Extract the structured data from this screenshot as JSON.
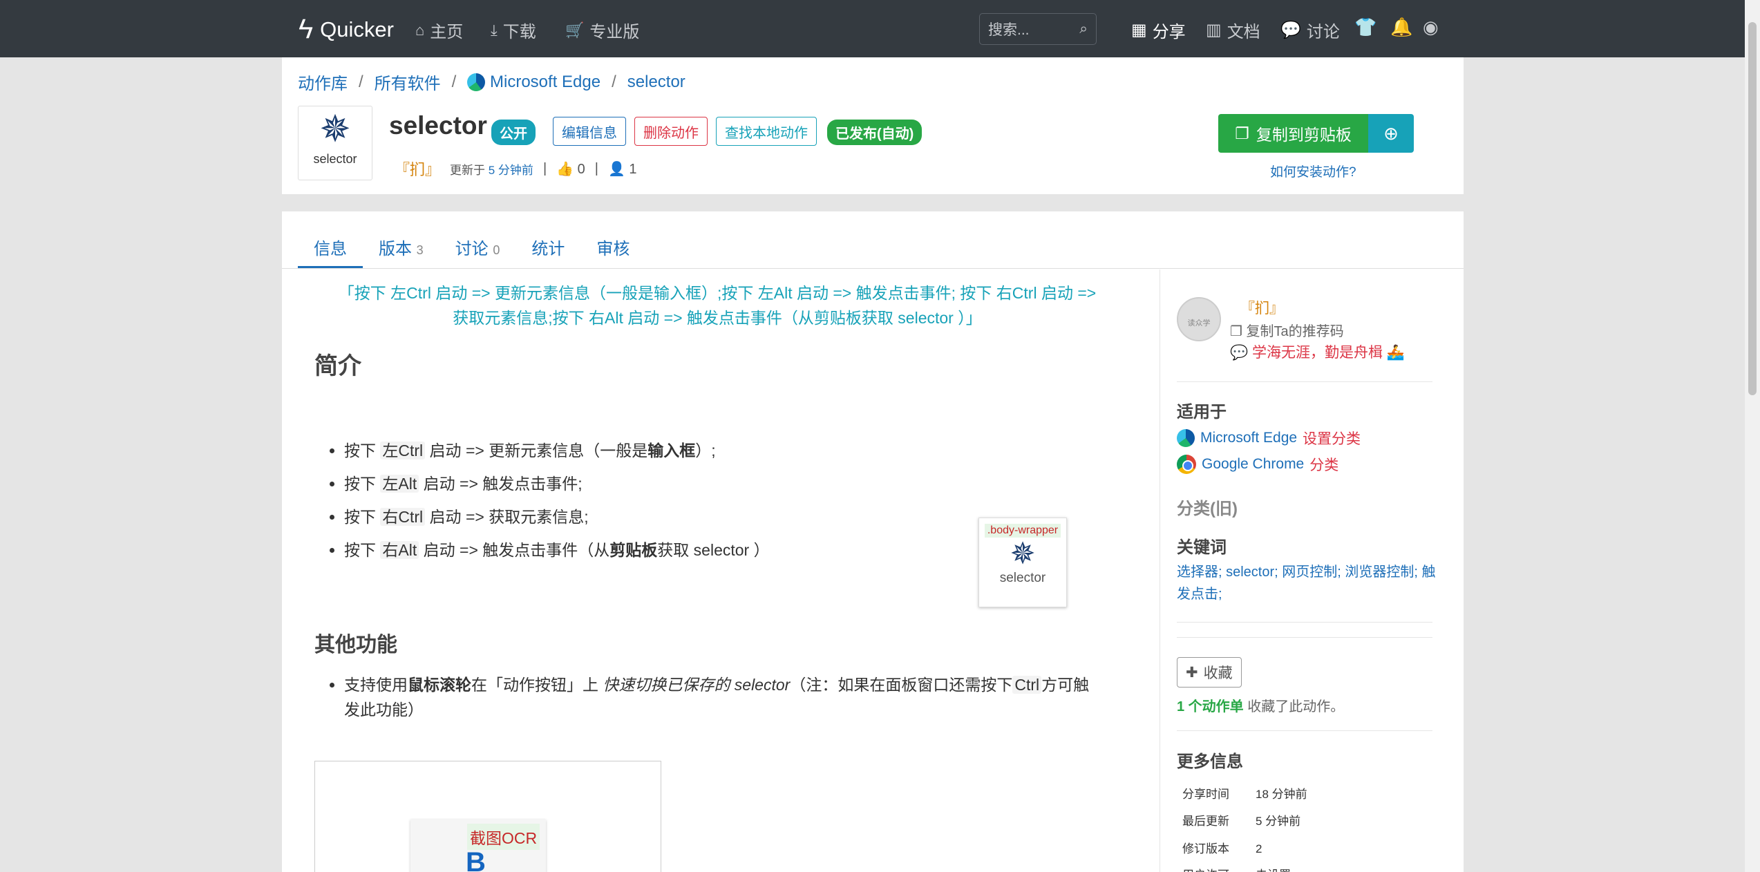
{
  "nav": {
    "brand": "Quicker",
    "home": "主页",
    "download": "下载",
    "pro": "专业版",
    "search_placeholder": "搜索...",
    "share": "分享",
    "docs": "文档",
    "discuss": "讨论"
  },
  "breadcrumb": [
    "动作库",
    "所有软件",
    "Microsoft Edge",
    "selector"
  ],
  "breadcrumb_sep": "/",
  "action": {
    "thumb_caption": "selector",
    "title": "selector",
    "public_badge": "公开",
    "edit": "编辑信息",
    "delete": "删除动作",
    "find_local": "查找本地动作",
    "published": "已发布(自动)",
    "author": "『扪』",
    "updated": "更新于",
    "updated_time": "5 分钟前",
    "likes": "0",
    "users": "1",
    "meta_sep": "|"
  },
  "buttons": {
    "copy": "复制到剪贴板",
    "howto": "如何安装动作?"
  },
  "tabs": [
    {
      "label": "信息",
      "count": ""
    },
    {
      "label": "版本",
      "count": "3"
    },
    {
      "label": "讨论",
      "count": "0"
    },
    {
      "label": "统计",
      "count": ""
    },
    {
      "label": "审核",
      "count": ""
    }
  ],
  "content": {
    "quote_line1": "「按下 左Ctrl 启动 => 更新元素信息（一般是输入框）;按下 左Alt 启动 => 触发点击事件;  按下 右Ctrl 启动 =>",
    "quote_line2": "获取元素信息;按下 右Alt 启动 => 触发点击事件（从剪贴板获取 selector ）」",
    "intro_heading": "简介",
    "intro_items": [
      {
        "pre": "按下 ",
        "key": "左Ctrl",
        "mid": " 启动 => 更新元素信息（一般是",
        "bold": "输入框",
        "post": "）;"
      },
      {
        "pre": "按下 ",
        "key": "左Alt",
        "mid": " 启动 => 触发点击事件;",
        "bold": "",
        "post": ""
      },
      {
        "pre": "按下 ",
        "key": "右Ctrl",
        "mid": " 启动 => 获取元素信息;",
        "bold": "",
        "post": ""
      },
      {
        "pre": "按下 ",
        "key": "右Alt",
        "mid": " 启动 => 触发点击事件（从",
        "bold": "剪贴板",
        "post": "获取 selector ）"
      }
    ],
    "overlay_label": ".body-wrapper",
    "overlay_caption": "selector",
    "other_heading": "其他功能",
    "other_pre": "支持使用",
    "other_bold": "鼠标滚轮",
    "other_mid": "在「动作按钮」上 ",
    "other_em": "快速切换已保存的 selector",
    "other_post1": "（注：如果在面板窗口还需按下",
    "other_key": "Ctrl",
    "other_post2": "方可触",
    "other_line2": "发此功能）",
    "ocr_label": "截图OCR"
  },
  "sidebar": {
    "author": "『扪』",
    "avatar_text": "读众学",
    "ref": "复制Ta的推荐码",
    "motto": "学海无涯，勤是舟楫",
    "applies_heading": "适用于",
    "apps": [
      {
        "name": "Microsoft Edge",
        "action": "设置分类"
      },
      {
        "name": "Google Chrome",
        "action": "分类"
      }
    ],
    "cat_old": "分类(旧)",
    "kw_heading": "关键词",
    "keywords": "选择器; selector; 网页控制; 浏览器控制; 触发点击;",
    "fav_btn": "收藏",
    "fav_count": "1 个动作单",
    "fav_text": " 收藏了此动作。",
    "more_heading": "更多信息",
    "info": [
      {
        "k": "分享时间",
        "v": "18 分钟前"
      },
      {
        "k": "最后更新",
        "v": "5 分钟前"
      },
      {
        "k": "修订版本",
        "v": "2"
      },
      {
        "k": "用户许可",
        "v": "未设置"
      }
    ]
  },
  "colors": {
    "navbar": "#343a40",
    "link": "#1e6fb8",
    "success": "#28a745",
    "info": "#17a2b8",
    "danger": "#dc3545"
  }
}
